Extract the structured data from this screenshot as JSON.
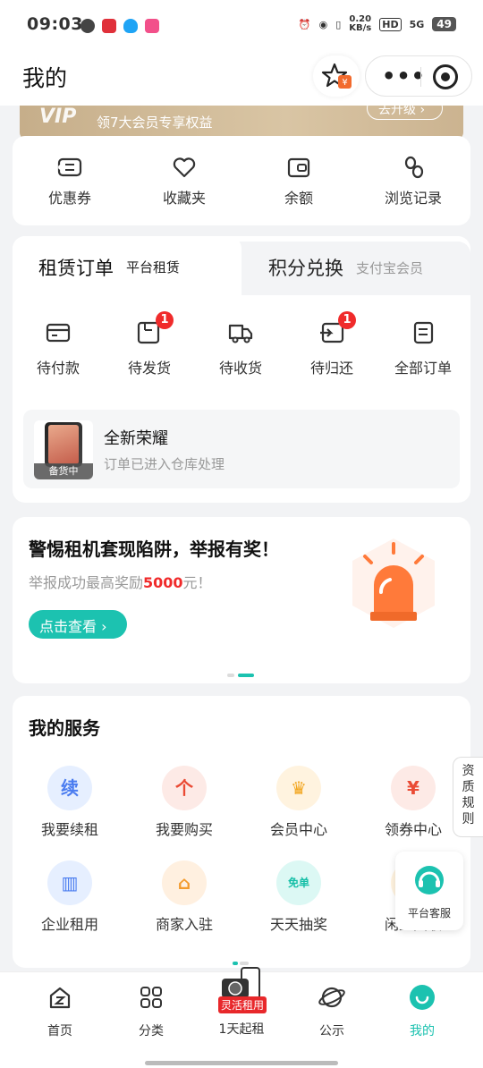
{
  "status_bar": {
    "time": "09:03",
    "net_speed_value": "0.20",
    "net_speed_unit": "KB/s",
    "hd": "HD",
    "signal": "5G",
    "battery": "49"
  },
  "header": {
    "title": "我的"
  },
  "banner": {
    "text": "领7大会员专享权益",
    "button": "去升级"
  },
  "quick_links": [
    {
      "label": "优惠券",
      "icon": "coupon-icon"
    },
    {
      "label": "收藏夹",
      "icon": "heart-icon"
    },
    {
      "label": "余额",
      "icon": "wallet-icon"
    },
    {
      "label": "浏览记录",
      "icon": "footprint-icon"
    }
  ],
  "orders": {
    "tab_active_title": "租赁订单",
    "tab_active_sub": "平台租赁",
    "tab_inactive_title": "积分兑换",
    "tab_inactive_sub": "支付宝会员",
    "items": [
      {
        "label": "待付款",
        "badge": ""
      },
      {
        "label": "待发货",
        "badge": "1"
      },
      {
        "label": "待收货",
        "badge": ""
      },
      {
        "label": "待归还",
        "badge": "1"
      },
      {
        "label": "全部订单",
        "badge": ""
      }
    ],
    "latest": {
      "name": "全新荣耀",
      "status": "订单已进入仓库处理",
      "tag": "备货中"
    }
  },
  "promo": {
    "title": "警惕租机套现陷阱，举报有奖！",
    "sub_prefix": "举报成功最高奖励",
    "sub_amount": "5000",
    "sub_suffix": "元！",
    "button": "点击查看"
  },
  "services": {
    "title": "我的服务",
    "items": [
      {
        "label": "我要续租",
        "glyph": "续",
        "bg": "#e6efff",
        "fg": "#4a7cf0"
      },
      {
        "label": "我要购买",
        "glyph": "个",
        "bg": "#fdeae6",
        "fg": "#ea4a34"
      },
      {
        "label": "会员中心",
        "glyph": "♛",
        "bg": "#fff3df",
        "fg": "#f2a51d"
      },
      {
        "label": "领券中心",
        "glyph": "¥",
        "bg": "#fdeae6",
        "fg": "#ea4a34"
      },
      {
        "label": "企业租用",
        "glyph": "▥",
        "bg": "#e6efff",
        "fg": "#4a7cf0"
      },
      {
        "label": "商家入驻",
        "glyph": "⌂",
        "bg": "#fff0e0",
        "fg": "#f39a2b"
      },
      {
        "label": "天天抽奖",
        "glyph": "免单",
        "bg": "#dcf8f4",
        "fg": "#16bfa7"
      },
      {
        "label": "闲置回收",
        "glyph": "♻",
        "bg": "#fff3df",
        "fg": "#f2a51d"
      }
    ]
  },
  "side_pill": "资质规则",
  "customer_service": "平台客服",
  "tabbar": [
    {
      "label": "首页",
      "active": false
    },
    {
      "label": "分类",
      "active": false
    },
    {
      "label": "1天起租",
      "active": false,
      "ribbon": "灵活租用"
    },
    {
      "label": "公示",
      "active": false
    },
    {
      "label": "我的",
      "active": true
    }
  ],
  "colors": {
    "accent": "#1cc2b0",
    "badge": "#f02b2b"
  }
}
